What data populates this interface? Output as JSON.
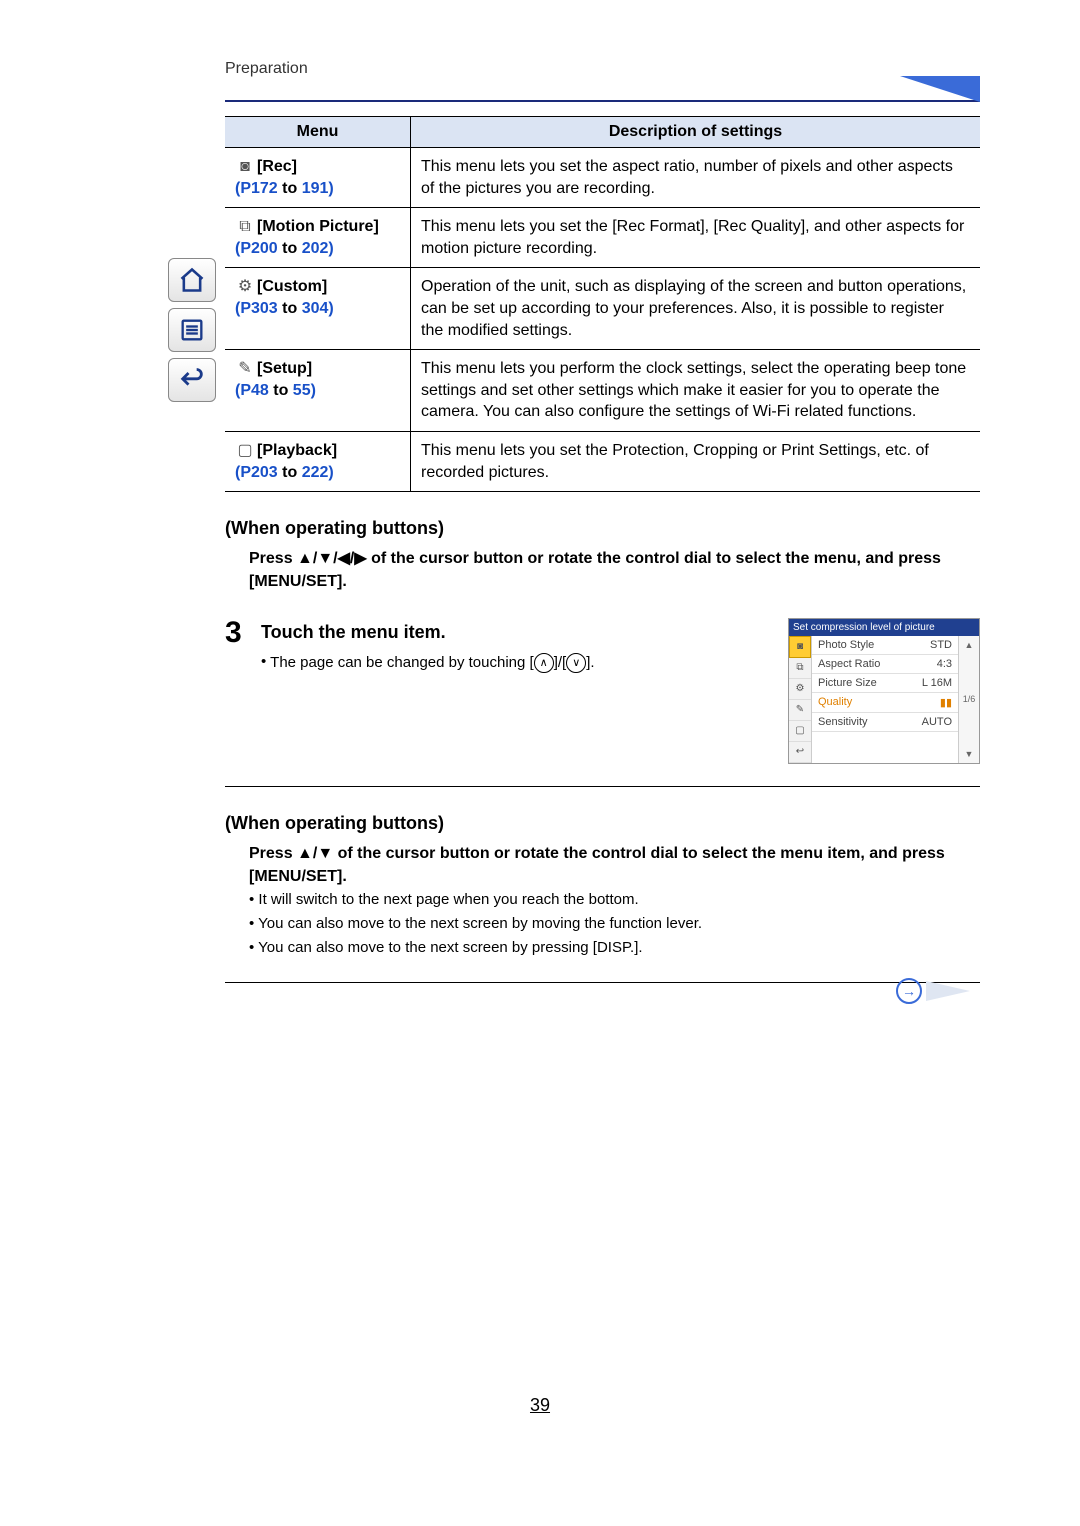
{
  "breadcrumb": "Preparation",
  "page_number": "39",
  "table": {
    "headers": {
      "menu": "Menu",
      "desc": "Description of settings"
    },
    "rows": [
      {
        "icon": "◙",
        "name": "[Rec]",
        "ref_pre": "(P172",
        "ref_mid": " to ",
        "ref_post": "191)",
        "desc": "This menu lets you set the aspect ratio, number of pixels and other aspects of the pictures you are recording."
      },
      {
        "icon": "⧉",
        "name": "[Motion Picture]",
        "ref_pre": "(P200",
        "ref_mid": " to ",
        "ref_post": "202)",
        "desc": "This menu lets you set the [Rec Format], [Rec Quality], and other aspects for motion picture recording."
      },
      {
        "icon": "⚙",
        "name": "[Custom]",
        "ref_pre": "(P303",
        "ref_mid": " to ",
        "ref_post": "304)",
        "desc": "Operation of the unit, such as displaying of the screen and button operations, can be set up according to your preferences. Also, it is possible to register the modified settings."
      },
      {
        "icon": "✎",
        "name": "[Setup]",
        "ref_pre": "(P48",
        "ref_mid": " to ",
        "ref_post": "55)",
        "desc": "This menu lets you perform the clock settings, select the operating beep tone settings and set other settings which make it easier for you to operate the camera.\nYou can also configure the settings of Wi-Fi related functions."
      },
      {
        "icon": "▢",
        "name": "[Playback]",
        "ref_pre": "(P203",
        "ref_mid": " to ",
        "ref_post": "222)",
        "desc": "This menu lets you set the Protection, Cropping or Print Settings, etc. of recorded pictures."
      }
    ]
  },
  "section1": {
    "heading": "(When operating buttons)",
    "text": "Press ▲/▼/◀/▶ of the cursor button or rotate the control dial to select the menu, and press [MENU/SET]."
  },
  "step3": {
    "num": "3",
    "title": "Touch the menu item.",
    "bullet_pre": "The page can be changed by touching [",
    "bullet_mid": "]/[",
    "bullet_post": "]."
  },
  "screenshot": {
    "title": "Set compression level of picture",
    "items": [
      {
        "label": "Photo Style",
        "value": "STD"
      },
      {
        "label": "Aspect Ratio",
        "value": "4:3"
      },
      {
        "label": "Picture Size",
        "value": "L 16M"
      },
      {
        "label": "Quality",
        "value": "▮▮"
      },
      {
        "label": "Sensitivity",
        "value": "AUTO"
      }
    ],
    "page_indicator": "1/6"
  },
  "section2": {
    "heading": "(When operating buttons)",
    "text": "Press ▲/▼ of the cursor button or rotate the control dial to select the menu item, and press [MENU/SET].",
    "bullets": [
      "It will switch to the next page when you reach the bottom.",
      "You can also move to the next screen by moving the function lever.",
      "You can also move to the next screen by pressing [DISP.]."
    ]
  }
}
